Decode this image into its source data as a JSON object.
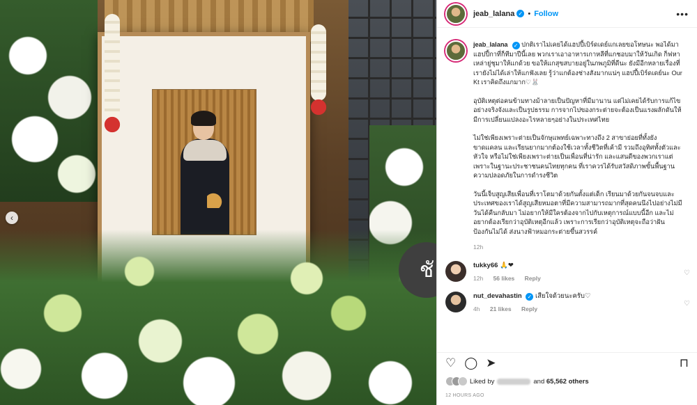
{
  "post": {
    "username": "jeab_lalana",
    "follow_label": "Follow",
    "more_label": "•••",
    "verified_mark": "✓"
  },
  "photo": {
    "carousel_prev": "‹",
    "ribbon_text": "ชั"
  },
  "caption": {
    "username": "jeab_lalana",
    "paragraphs": [
      "ปกติเราไม่เคยได้แฮปปี้เบิร์ดเดย์แกเลยขอโทษนะ พอได้มาแฮปปี้กาที่ก็ทีมาปีนี้เลย พวกเราเอาอาหารเกาหลีที่แกชอบมาให้วันเกิด ก็ฟหาเหล่ายู่ชุมาให้แกด้วย ขอให้แกสุขสบายอยู่ในภพภูมิที่ดีนะ ยังมีอีกหลายเรื่องที่เรายังไม่ได้เล่าให้แกฟังเลย รู้ว่าแกต้องช่างสังมากแน่ๆ แฮปปี้เบิร์ดเดย์นะ Our Kt เราคิดถึงแกมาก♡🐰",
      "อุบัติเหตุต่อคนข้ามทางม้าลายเป็นปัญหาที่มีมานาน แต่ไม่เคยได้รับการแก้ไขอย่างจริงจังและเป็นรูปธรรม การจากไปของกระต่ายจะต้องเป็นแรงผลักดันให้มีการเปลี่ยนแปลงอะไรหลายๆอย่างในประเทศไทย",
      "ไม่ใช่เพียงเพราะต่ายเป็นจักษุแพทย์เฉพาะทางถึง 2 สาขาย่อยที่ทั้งยังขาดแคลน และเรียนยากมากต้องใช้เวลาทั้งชีวิตที่เค้ามี รวมถึงอุทิศทั้งตัวและหัวใจ หรือไม่ใช่เพียงเพราะต่ายเป็นเพื่อนที่น่ารัก และแสนดีของพวกเราแต่เพราะในฐานะประชาชนคนไทยทุกคน ที่เราควรได้รับสวัสดิภาพขั้นพื้นฐานความปลอดภัยในการดำรงชีวิต",
      "วันนี้เจ็บสูญเสียเพื่อนที่เราโตมาด้วยกันตั้งแต่เด็ก เรียนมาด้วยกันจนจบและประเทศของเราได้สูญเสียหมอตาที่มีความสามารถมากที่สุดคนนึงไปอย่างไม่มีวันได้คืนกลับมา ไม่อยากให้มีใครต้องจากไปกับเหตุการณ์แบบนี้อีก และไม่อยากต้องเรียกว่าอุบัติเหตุอีกแล้ว เพราะการเรียกว่าอุบัติเหตุจะถือว่าฝันป้องกันไม่ได้ ส่งนางฟ้าหมอกระต่ายขึ้นสวรรค์"
    ],
    "time": "12h"
  },
  "comments": [
    {
      "username": "tukky66",
      "text": "🙏❤",
      "time": "12h",
      "likes": "56 likes",
      "reply": "Reply",
      "like_icon": "♡"
    },
    {
      "username": "nut_devahastin",
      "text": "เสียใจด้วยนะครับ♡",
      "time": "4h",
      "likes": "21 likes",
      "reply": "Reply",
      "like_icon": "♡"
    }
  ],
  "actions": {
    "like_icon": "♡",
    "comment_icon": "◯",
    "share_icon": "➤",
    "save_icon": "⊓"
  },
  "likes": {
    "prefix": "Liked by",
    "connector": "and",
    "count": "65,562 others"
  },
  "timestamp": "12 HOURS AGO",
  "colors": {
    "link_blue": "#0095f6",
    "heart_red": "#ed4956",
    "muted": "#8e8e8e"
  }
}
